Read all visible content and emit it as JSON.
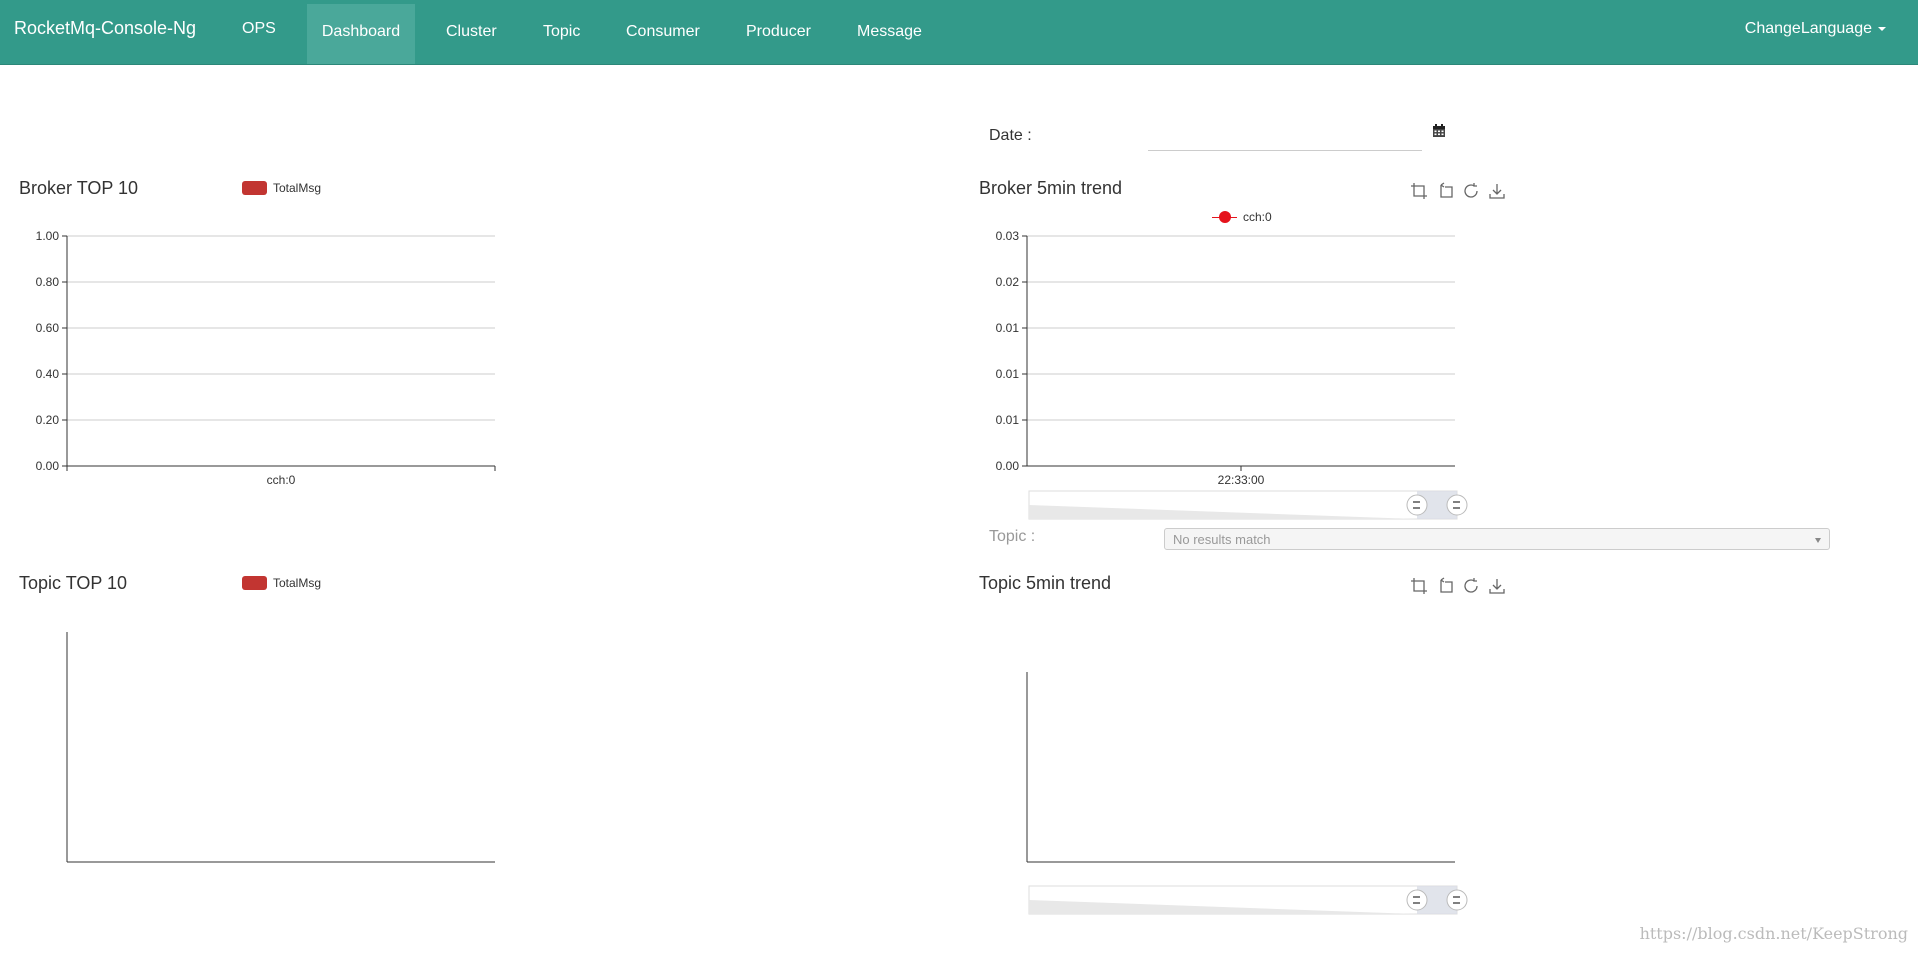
{
  "navbar": {
    "brand": "RocketMq-Console-Ng",
    "items": [
      "OPS",
      "Dashboard",
      "Cluster",
      "Topic",
      "Consumer",
      "Producer",
      "Message"
    ],
    "active": "Dashboard",
    "language": "ChangeLanguage"
  },
  "filters": {
    "date_label": "Date :",
    "date_value": "",
    "topic_label": "Topic :",
    "topic_placeholder": "No results match"
  },
  "colors": {
    "navbar": "#339a8a",
    "active_nav": "#4aa89a",
    "series_bar": "#c23531",
    "series_line": "#e5131c"
  },
  "charts": {
    "broker_top10": {
      "title": "Broker TOP 10",
      "legend": "TotalMsg"
    },
    "broker_trend": {
      "title": "Broker 5min trend",
      "legend": "cch:0"
    },
    "topic_top10": {
      "title": "Topic TOP 10",
      "legend": "TotalMsg"
    },
    "topic_trend": {
      "title": "Topic 5min trend"
    }
  },
  "chart_data": [
    {
      "type": "bar",
      "title": "Broker TOP 10",
      "categories": [
        "cch:0"
      ],
      "series": [
        {
          "name": "TotalMsg",
          "values": [
            0
          ]
        }
      ],
      "yticks": [
        "0.00",
        "0.20",
        "0.40",
        "0.60",
        "0.80",
        "1.00"
      ],
      "ylim": [
        0,
        1
      ],
      "grid": true
    },
    {
      "type": "line",
      "title": "Broker 5min trend",
      "x": [
        "22:33:00"
      ],
      "series": [
        {
          "name": "cch:0",
          "values": []
        }
      ],
      "yticks": [
        "0.00",
        "0.01",
        "0.01",
        "0.01",
        "0.02",
        "0.03"
      ],
      "ylim": [
        0,
        0.03
      ],
      "grid": true
    },
    {
      "type": "bar",
      "title": "Topic TOP 10",
      "categories": [],
      "series": [
        {
          "name": "TotalMsg",
          "values": []
        }
      ],
      "yticks": [],
      "grid": false
    },
    {
      "type": "line",
      "title": "Topic 5min trend",
      "x": [],
      "series": [],
      "yticks": [],
      "grid": false
    }
  ],
  "watermark": "https://blog.csdn.net/KeepStrong"
}
